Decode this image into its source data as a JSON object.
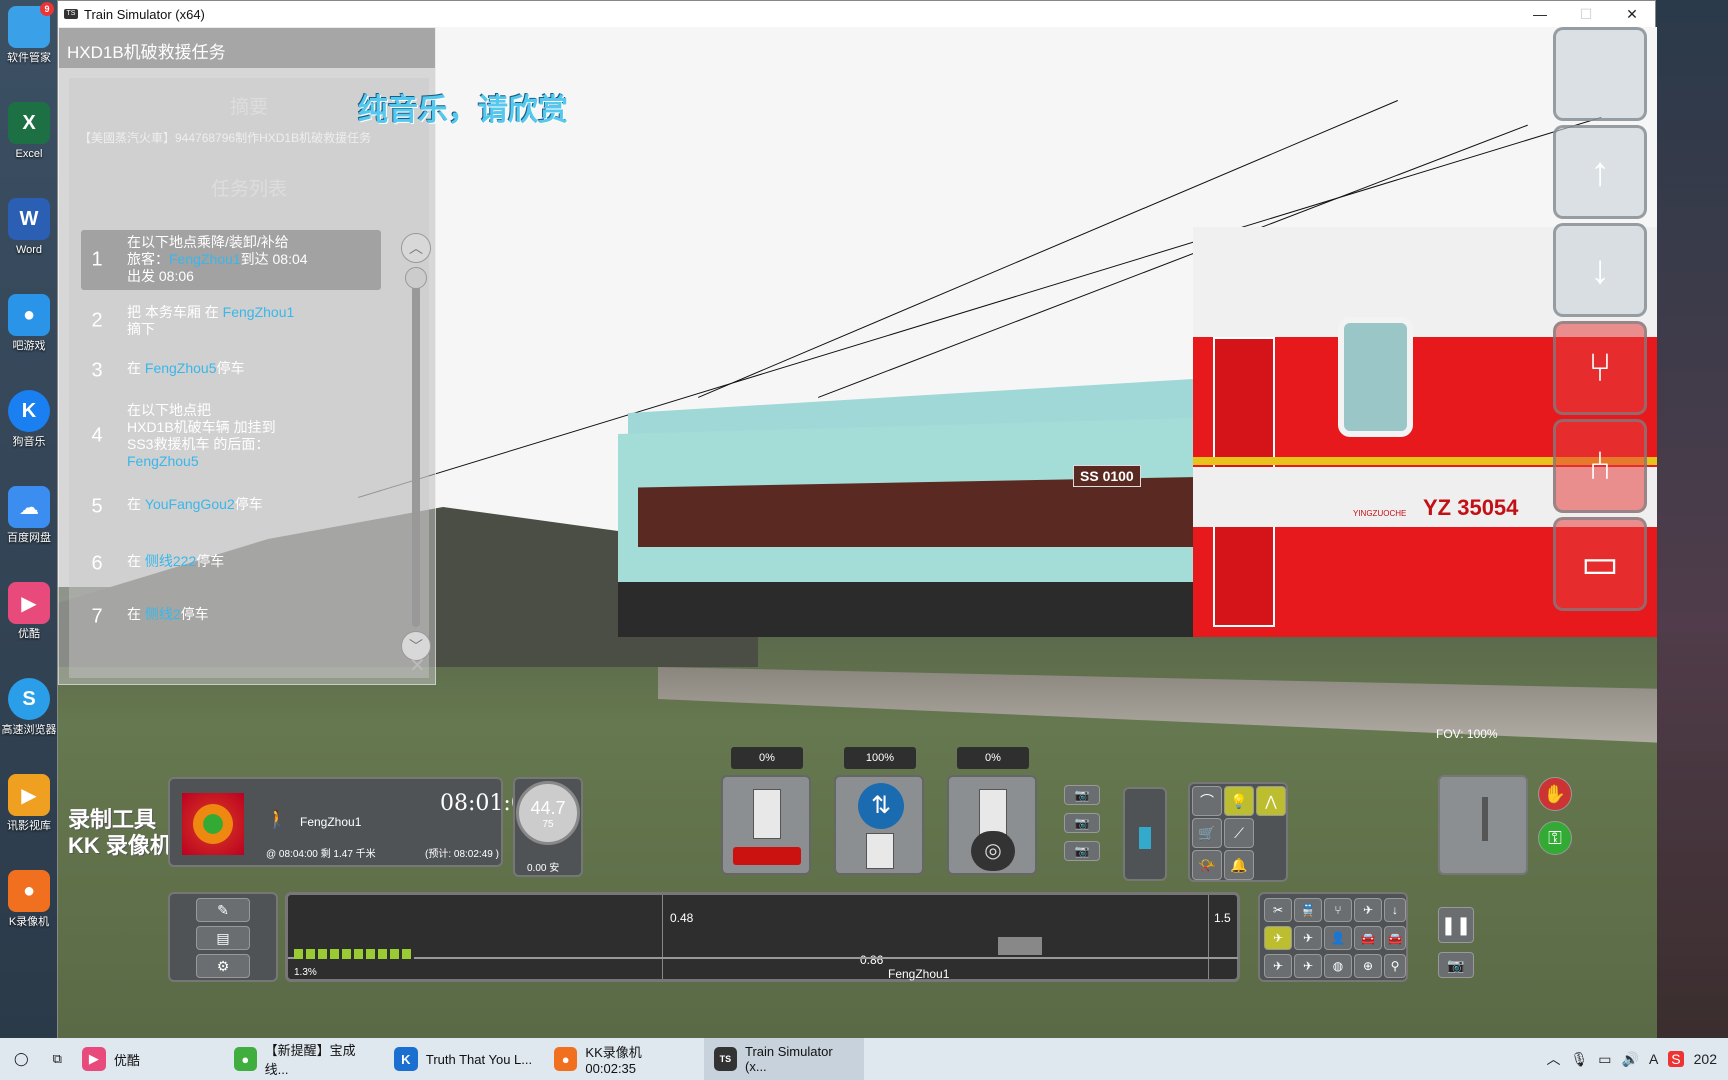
{
  "window": {
    "title": "Train Simulator (x64)"
  },
  "desktop_icons": [
    {
      "label": "软件管家",
      "badge": "9",
      "color": "#3aa0e8"
    },
    {
      "label": "Excel",
      "color": "#1d7044",
      "glyph": "X"
    },
    {
      "label": "Word",
      "color": "#2b5fb4",
      "glyph": "W"
    },
    {
      "label": "吧游戏",
      "color": "#2a95e8",
      "glyph": "●"
    },
    {
      "label": "狗音乐",
      "color": "#1a7ff0",
      "glyph": "K"
    },
    {
      "label": "百度网盘",
      "color": "#3b8ef0",
      "glyph": "☁"
    },
    {
      "label": "优酷",
      "color": "#e84a7c",
      "glyph": "▶"
    },
    {
      "label": "高速浏览器",
      "color": "#2a9ee8",
      "glyph": "S"
    },
    {
      "label": "讯影视库",
      "color": "#f0a020",
      "glyph": "▶"
    },
    {
      "label": "K录像机",
      "color": "#f07020",
      "glyph": "●"
    }
  ],
  "overlay_title": "纯音乐，请欣赏",
  "task_panel": {
    "title": "HXD1B机破救援任务",
    "summary_heading": "摘要",
    "summary_text": "【美國蒸汽火車】944768796制作HXD1B机破救援任务",
    "list_heading": "任务列表",
    "tasks": [
      {
        "num": "1",
        "line1": "在以下地点乘降/装卸/补给",
        "line2_pre": "旅客：",
        "line2_hl": "FengZhou1",
        "line2_post": "到达 08:04",
        "line3": "出发 08:06"
      },
      {
        "num": "2",
        "line1_pre": "把 本务车厢  在 ",
        "line1_hl": "FengZhou1",
        "line2": "摘下"
      },
      {
        "num": "3",
        "pre": "在 ",
        "hl": "FengZhou5",
        "post": "停车"
      },
      {
        "num": "4",
        "line1": "在以下地点把",
        "line2": "HXD1B机破车辆  加挂到",
        "line3": "SS3救援机车  的后面：",
        "line4_hl": "FengZhou5"
      },
      {
        "num": "5",
        "pre": "在 ",
        "hl": "YouFangGou2",
        "post": "停车"
      },
      {
        "num": "6",
        "pre": "在 ",
        "hl": "侧线222",
        "post": "停车"
      },
      {
        "num": "7",
        "pre": "在 ",
        "hl": "侧线2",
        "post": "停车"
      }
    ]
  },
  "loco": {
    "plate": "SS 0100"
  },
  "car": {
    "code": "YZ 35054",
    "brand": "YINGZUOCHE"
  },
  "hud": {
    "clock": "08:01:06",
    "station": "FengZhou1",
    "arrival_line": "@  08:04:00  剩  1.47 千米",
    "eta": "(预计: 08:02:49 )",
    "speed": "44.7",
    "speed_limit": "75",
    "current": "0.00 安",
    "throttle_pct": "0%",
    "reverser_pct": "100%",
    "brake_pct": "0%",
    "fov": "FOV: 100%",
    "track_marker1": "0.48",
    "track_marker2": "1.5",
    "track_distance": "0.86",
    "track_station": "FengZhou1",
    "grade": "1.3%"
  },
  "watermark": {
    "line1": "录制工具",
    "line2": "KK 录像机"
  },
  "taskbar": {
    "items": [
      {
        "label": "优酷",
        "color": "#e84a7c",
        "glyph": "▶"
      },
      {
        "label": "【新提醒】宝成线...",
        "color": "#3fae3f",
        "glyph": "●"
      },
      {
        "label": "Truth That You L...",
        "color": "#1a6fd0",
        "glyph": "K"
      },
      {
        "label": "KK录像机 00:02:35",
        "color": "#f07020",
        "glyph": "●"
      },
      {
        "label": "Train Simulator (x...",
        "color": "#333333",
        "glyph": "TS"
      }
    ],
    "clock": "202"
  }
}
